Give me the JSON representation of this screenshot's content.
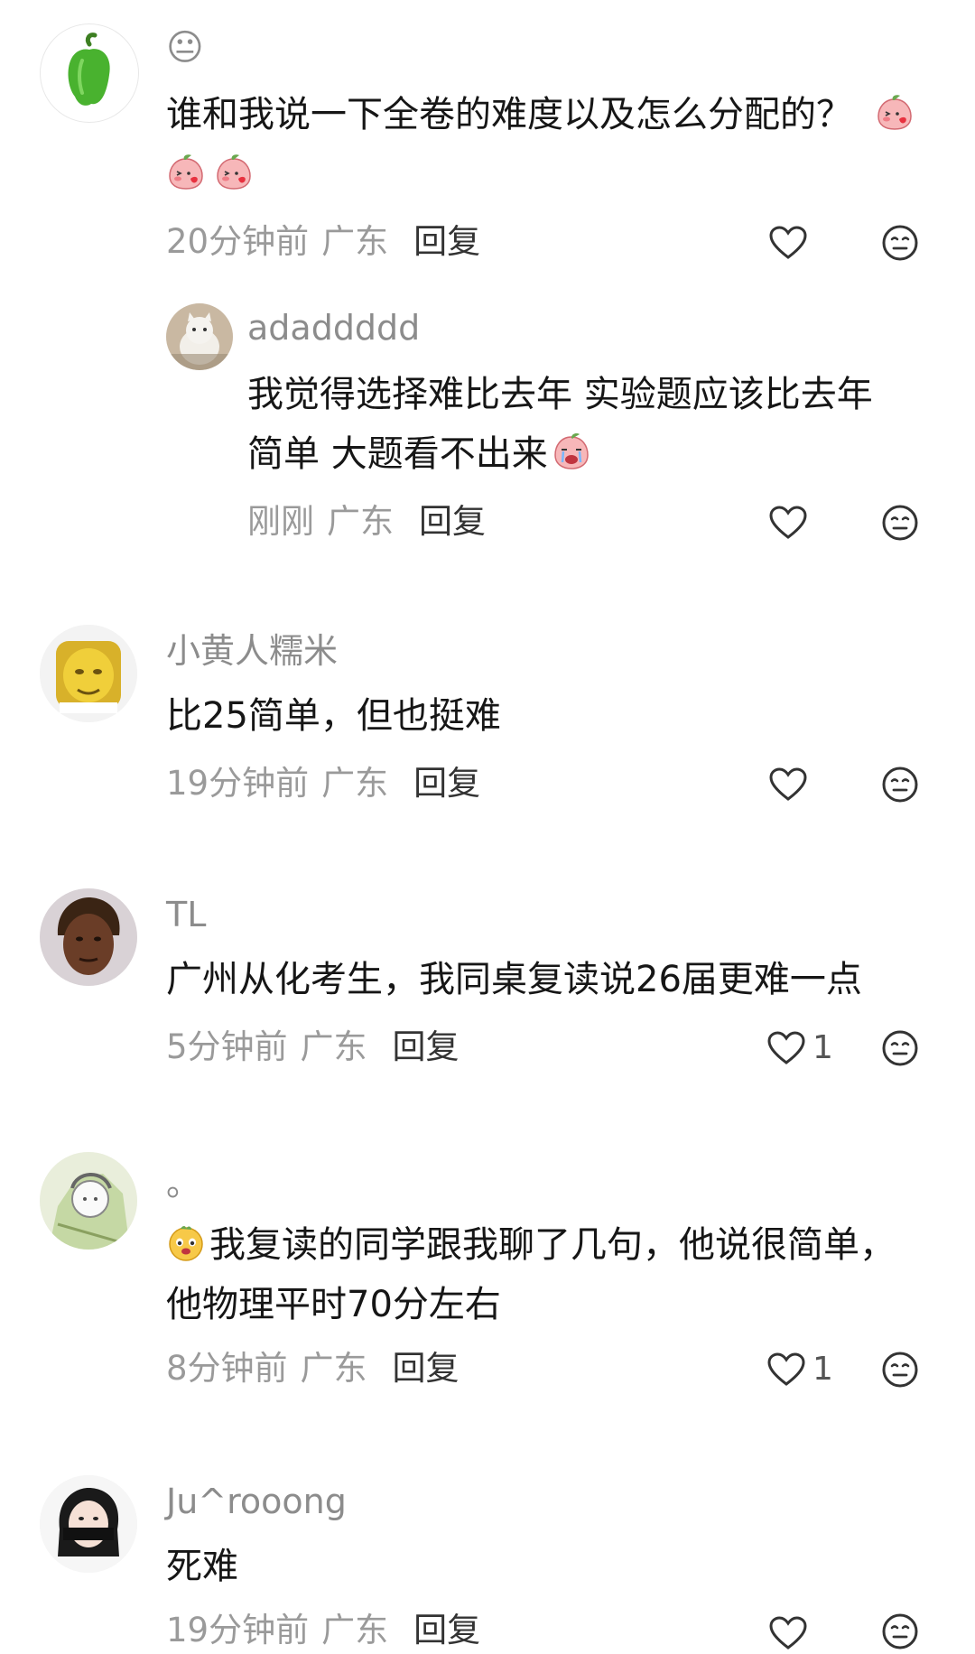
{
  "comments": [
    {
      "username": "😐",
      "content_line1": "谁和我说一下全卷的难度以及怎么分配的？",
      "time": "20分钟前",
      "location": "广东",
      "reply_label": "回复",
      "likes": "",
      "replies": [
        {
          "username": "adaddddd",
          "content_line1": "我觉得选择难比去年 实验题应该比去年",
          "content_line2": "简单 大题看不出来",
          "time": "刚刚",
          "location": "广东",
          "reply_label": "回复",
          "likes": ""
        }
      ]
    },
    {
      "username": "小黄人糯米",
      "content_line1": "比25简单，但也挺难",
      "time": "19分钟前",
      "location": "广东",
      "reply_label": "回复",
      "likes": ""
    },
    {
      "username": "TL",
      "content_line1": "广州从化考生，我同桌复读说26届更难一点",
      "time": "5分钟前",
      "location": "广东",
      "reply_label": "回复",
      "likes": "1"
    },
    {
      "username": "。",
      "content_line1": "我复读的同学跟我聊了几句，他说很简单，",
      "content_line2": "他物理平时70分左右",
      "time": "8分钟前",
      "location": "广东",
      "reply_label": "回复",
      "likes": "1"
    },
    {
      "username": "Ju^rooong",
      "content_line1": "死难",
      "time": "19分钟前",
      "location": "广东",
      "reply_label": "回复",
      "likes": ""
    }
  ],
  "icons": {
    "like": "heart-outline-icon",
    "react": "emoji-face-icon",
    "sticker_peach": "peach-kiss-sticker",
    "sticker_cry": "peach-cry-sticker",
    "sticker_yellow": "yellow-face-sticker"
  },
  "colors": {
    "username": "#8c8c8c",
    "meta": "#9a9a9a",
    "text": "#161616"
  }
}
